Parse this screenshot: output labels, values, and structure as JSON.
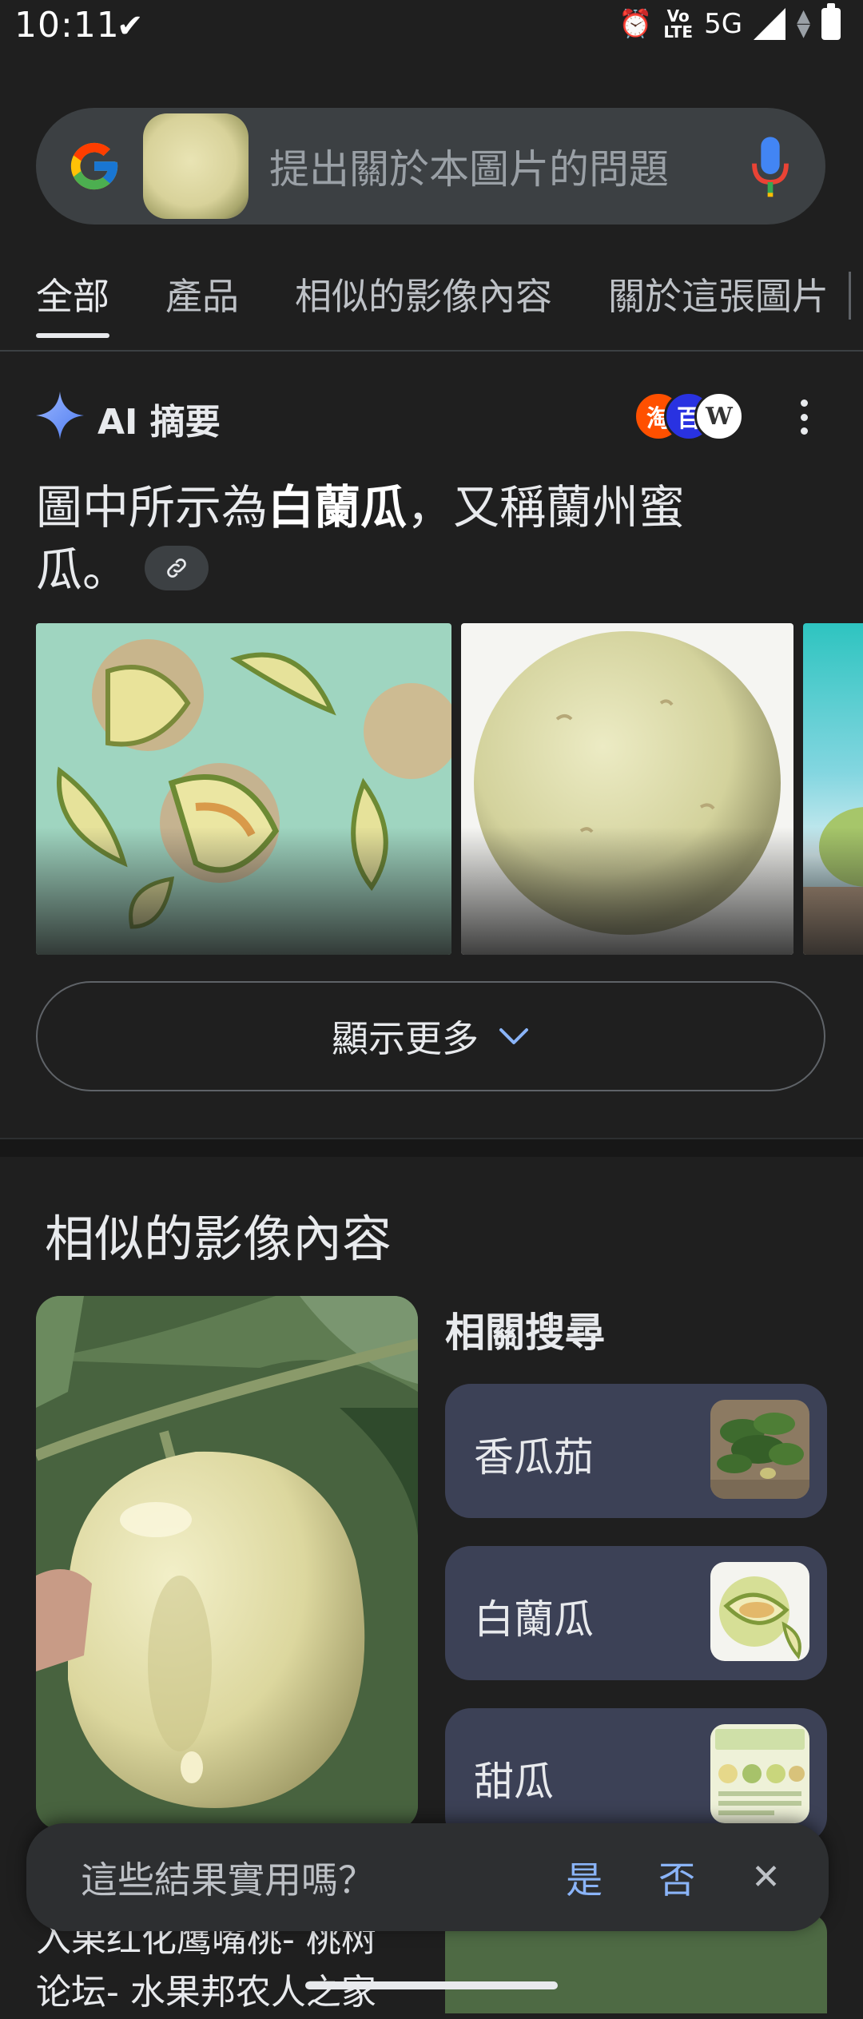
{
  "status_bar": {
    "time": "10:11",
    "network": "5G",
    "lte_top": "Vo",
    "lte_bottom": "LTE"
  },
  "search": {
    "placeholder": "提出關於本圖片的問題"
  },
  "tabs": [
    {
      "label": "全部",
      "active": true
    },
    {
      "label": "產品"
    },
    {
      "label": "相似的影像內容"
    },
    {
      "label": "關於這張圖片"
    }
  ],
  "ai_summary": {
    "title": "AI 摘要",
    "text_pre": "圖中所示為",
    "text_bold": "白蘭瓜",
    "text_post": "，又稱蘭州蜜瓜。",
    "sources": [
      "淘",
      "百",
      "W"
    ],
    "show_more": "顯示更多"
  },
  "similar": {
    "title": "相似的影像內容",
    "related_title": "相關搜尋",
    "related": [
      {
        "label": "香瓜茄"
      },
      {
        "label": "白蘭瓜"
      },
      {
        "label": "甜瓜"
      }
    ],
    "bottom_result_line1": "入果红化鹰嘴桃- 桃树",
    "bottom_result_line2": "论坛- 水果邦农人之家"
  },
  "feedback": {
    "question": "這些結果實用嗎？",
    "yes": "是",
    "no": "否"
  },
  "colors": {
    "accent": "#8ab4f8",
    "background": "#1f1f1f",
    "card": "#3c4156"
  }
}
